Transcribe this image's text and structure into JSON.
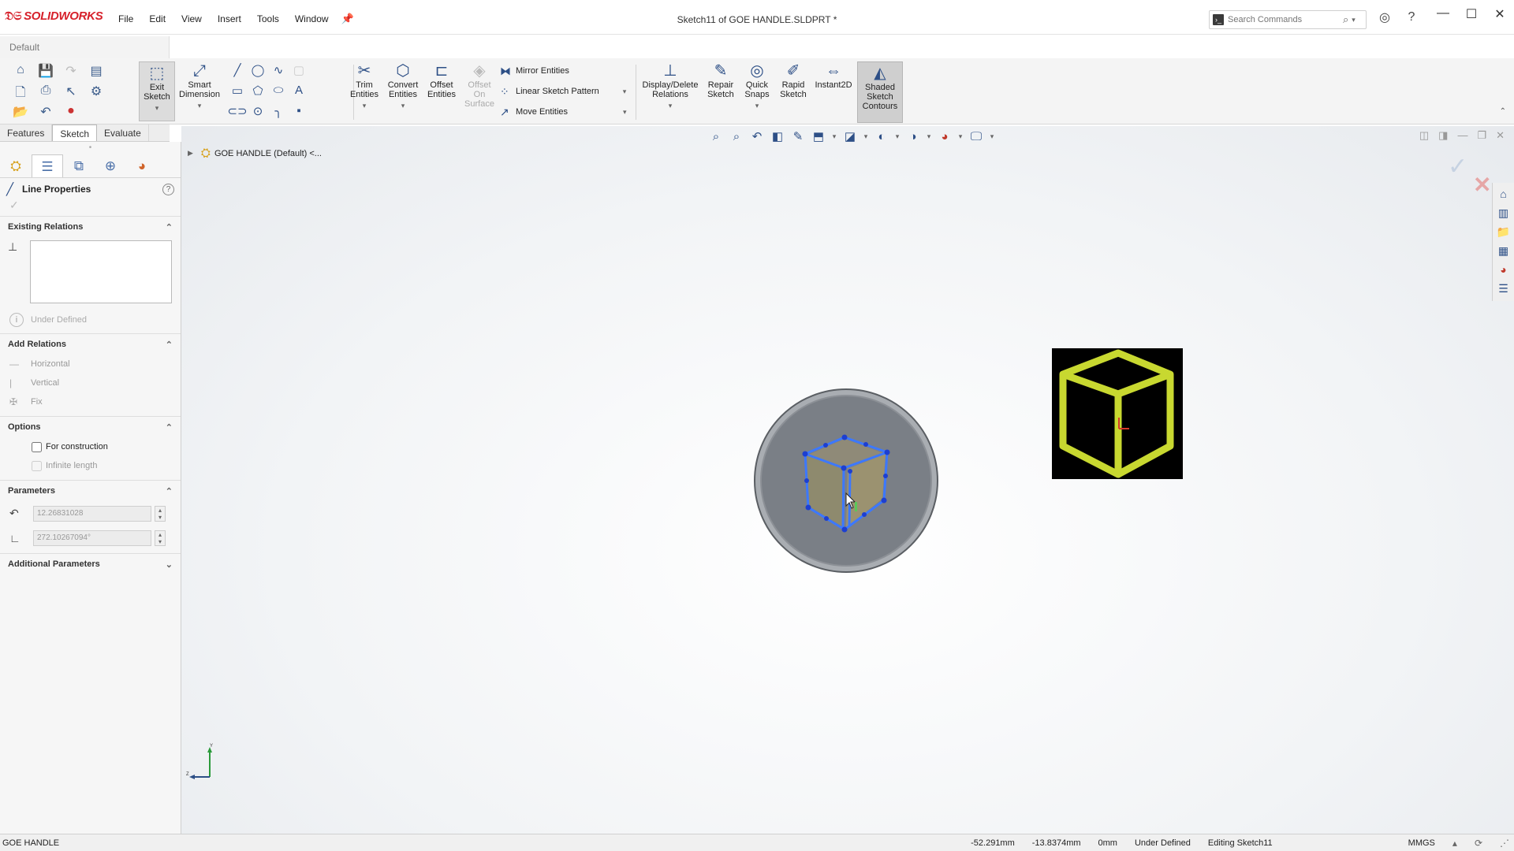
{
  "app": {
    "logo_text": "SOLIDWORKS",
    "title": "Sketch11 of GOE HANDLE.SLDPRT *",
    "menu": [
      "File",
      "Edit",
      "View",
      "Insert",
      "Tools",
      "Window"
    ],
    "search_placeholder": "Search Commands"
  },
  "config": {
    "selected": "Default"
  },
  "ribbon": {
    "exit_sketch": "Exit\nSketch",
    "smart_dimension": "Smart\nDimension",
    "trim_entities": "Trim\nEntities",
    "convert_entities": "Convert\nEntities",
    "offset_entities": "Offset\nEntities",
    "offset_on_surface": "Offset\nOn\nSurface",
    "mirror_entities": "Mirror Entities",
    "linear_sketch_pattern": "Linear Sketch Pattern",
    "move_entities": "Move Entities",
    "display_delete_relations": "Display/Delete\nRelations",
    "repair_sketch": "Repair\nSketch",
    "quick_snaps": "Quick\nSnaps",
    "rapid_sketch": "Rapid\nSketch",
    "instant2d": "Instant2D",
    "shaded_sketch_contours": "Shaded\nSketch\nContours"
  },
  "cm_tabs": [
    "Features",
    "Sketch",
    "Evaluate"
  ],
  "property_manager": {
    "title": "Line Properties",
    "existing_relations": "Existing Relations",
    "status": "Under Defined",
    "add_relations": "Add Relations",
    "relations": [
      "Horizontal",
      "Vertical",
      "Fix"
    ],
    "options": "Options",
    "for_construction": "For construction",
    "infinite_length": "Infinite length",
    "parameters": "Parameters",
    "length_value": "12.26831028",
    "angle_value": "272.10267094°",
    "additional_parameters": "Additional Parameters"
  },
  "tree": {
    "root": "GOE HANDLE  (Default) <..."
  },
  "status": {
    "part": "GOE HANDLE",
    "x": "-52.291mm",
    "y": "-13.8374mm",
    "z": "0mm",
    "definition": "Under Defined",
    "editing": "Editing Sketch11",
    "units": "MMGS"
  },
  "colors": {
    "accent": "#2d4f86",
    "sketch_blue": "#3c78ff",
    "decal_yellow": "#c8d830",
    "disc_grey": "#7a7f86"
  }
}
